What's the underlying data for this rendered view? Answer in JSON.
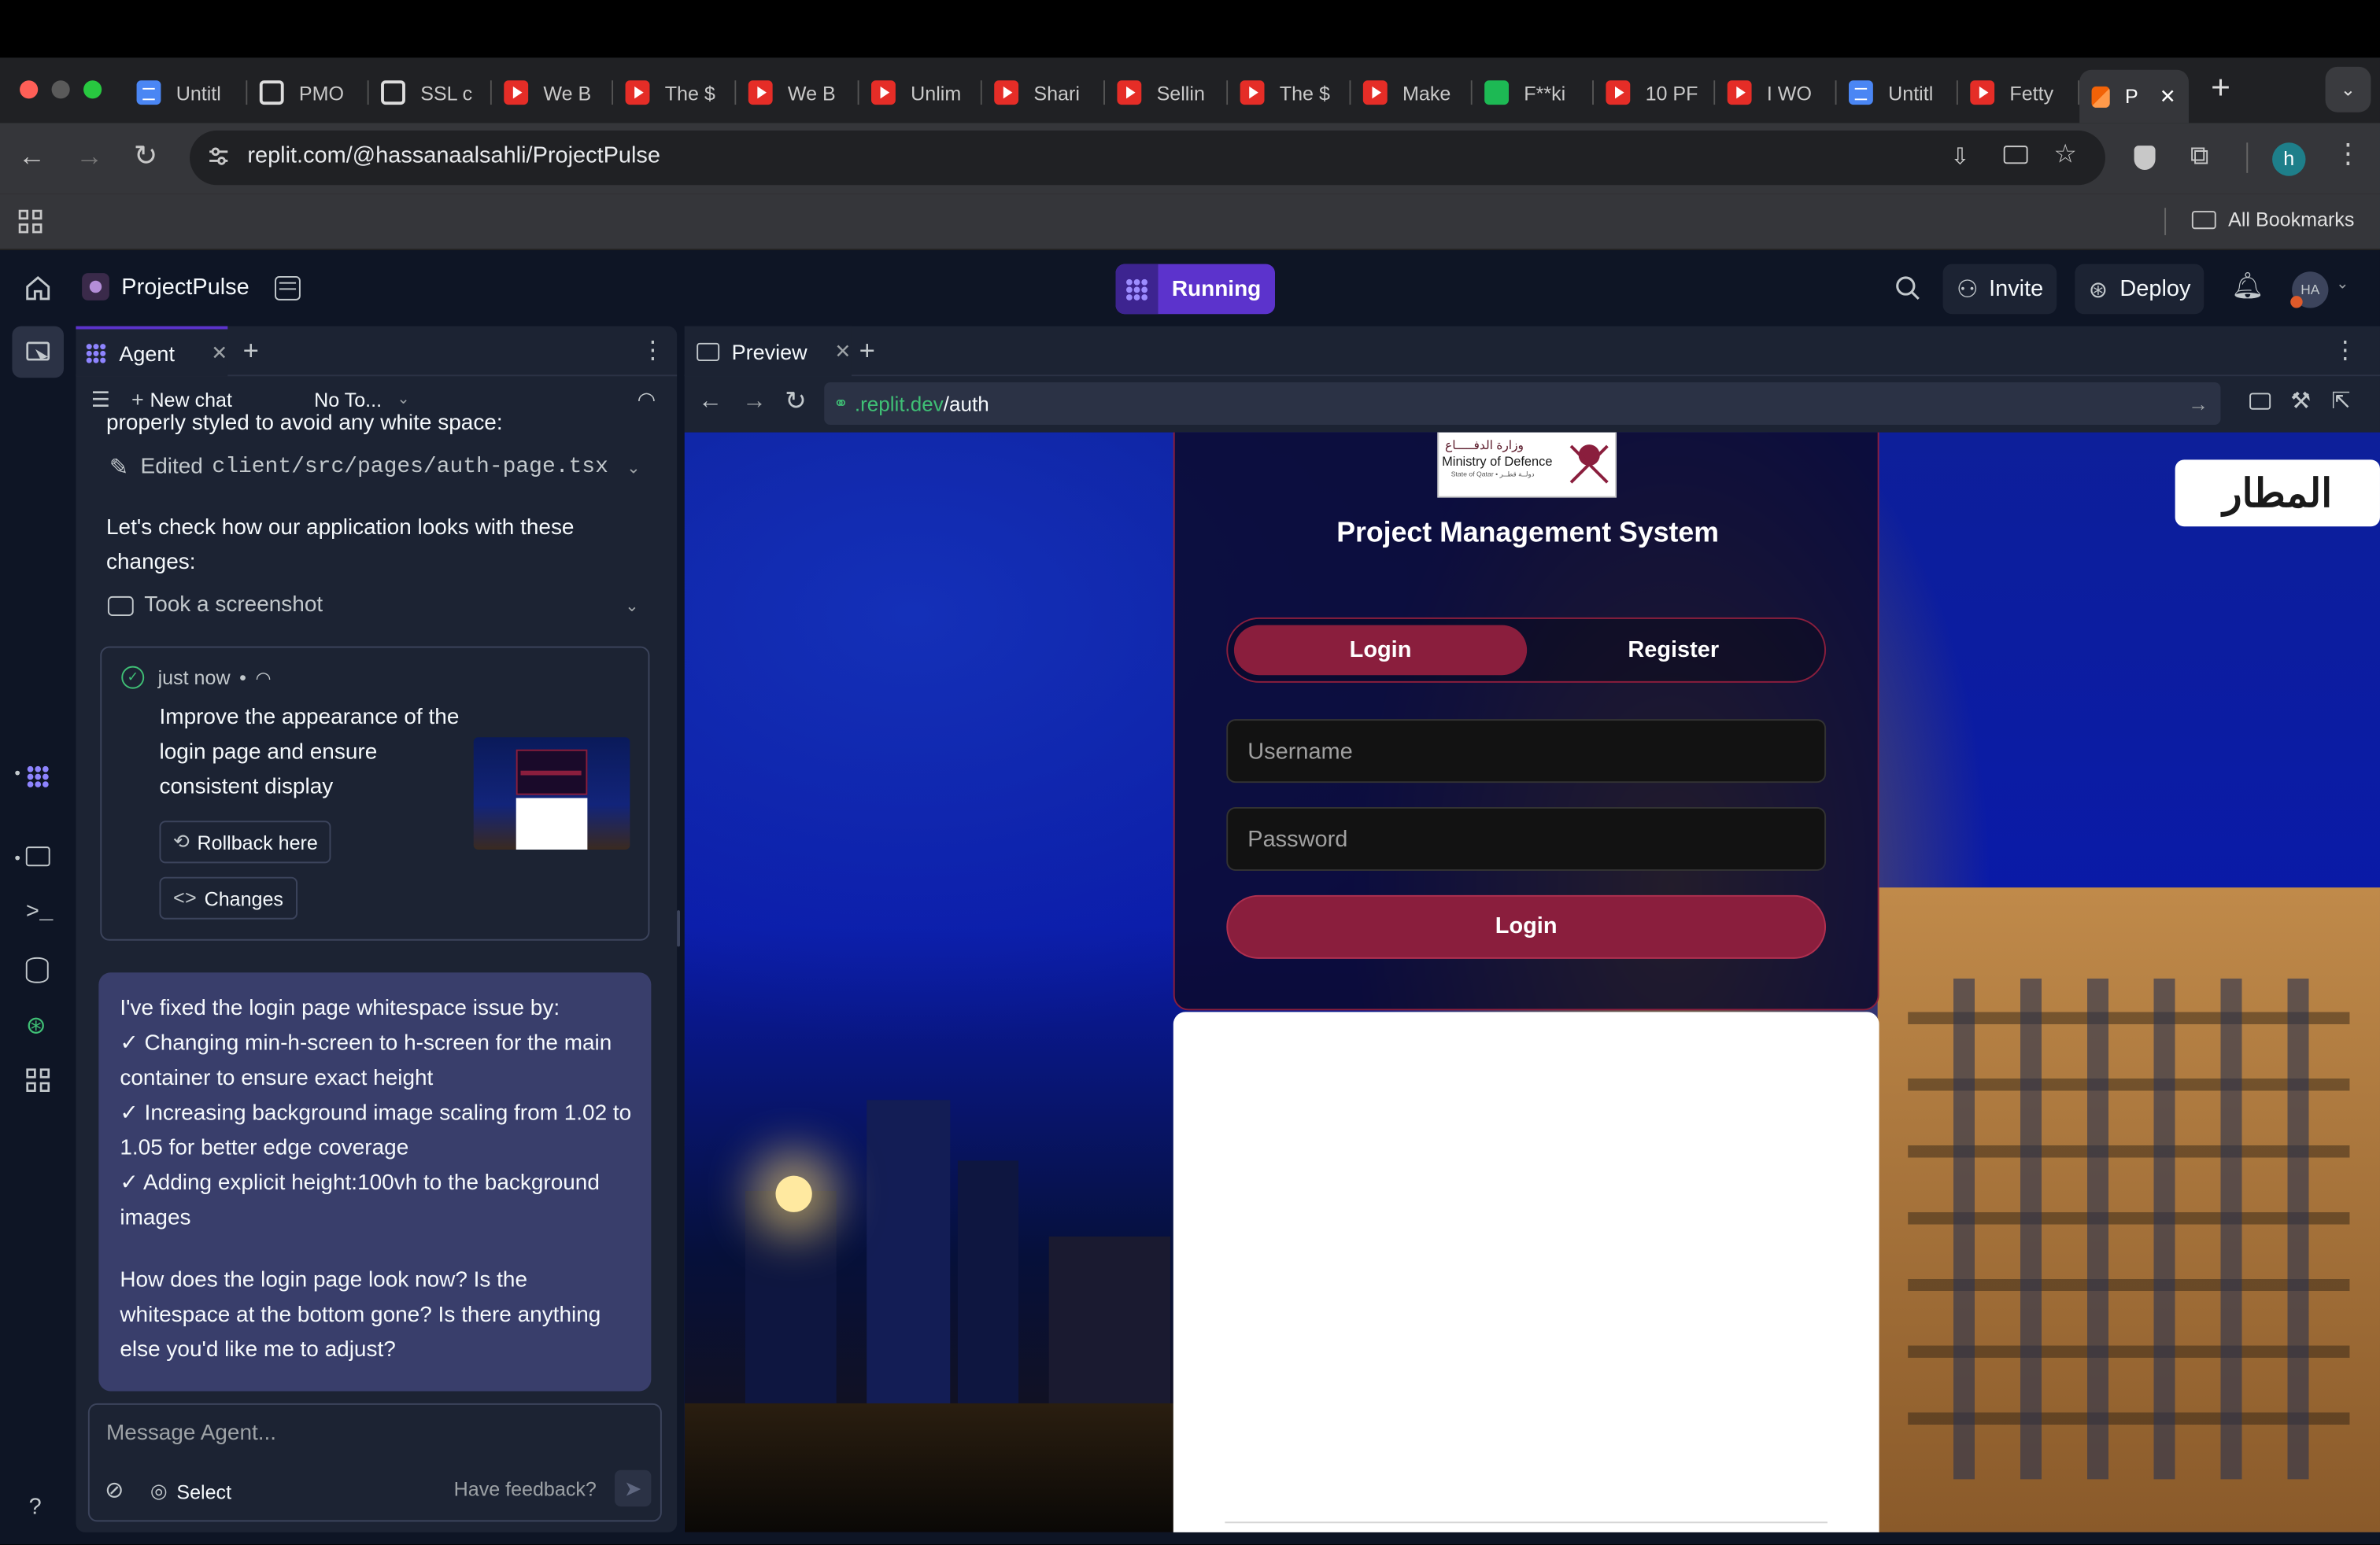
{
  "browser": {
    "tabs": [
      {
        "title": "Untitl",
        "icon": "docs"
      },
      {
        "title": "PMO",
        "icon": "chatgpt"
      },
      {
        "title": "SSL c",
        "icon": "chatgpt"
      },
      {
        "title": "We B",
        "icon": "youtube"
      },
      {
        "title": "The $",
        "icon": "youtube"
      },
      {
        "title": "We B",
        "icon": "youtube"
      },
      {
        "title": "Unlim",
        "icon": "youtube"
      },
      {
        "title": "Shari",
        "icon": "youtube"
      },
      {
        "title": "Sellin",
        "icon": "youtube"
      },
      {
        "title": "The $",
        "icon": "youtube"
      },
      {
        "title": "Make",
        "icon": "youtube"
      },
      {
        "title": "F**ki",
        "icon": "spotify"
      },
      {
        "title": "10 PF",
        "icon": "youtube"
      },
      {
        "title": "I WO",
        "icon": "youtube"
      },
      {
        "title": "Untitl",
        "icon": "docs"
      },
      {
        "title": "Fetty",
        "icon": "youtube"
      },
      {
        "title": "P",
        "icon": "replit",
        "active": true
      }
    ],
    "url": "replit.com/@hassanaalsahli/ProjectPulse",
    "all_bookmarks": "All Bookmarks",
    "profile_initial": "h"
  },
  "replit": {
    "project_name": "ProjectPulse",
    "run_status": "Running",
    "invite": "Invite",
    "deploy": "Deploy",
    "avatar": "HA",
    "accent": "#5c33cc"
  },
  "agent": {
    "tab_label": "Agent",
    "new_chat": "New chat",
    "model_select": "No To...",
    "truncated_text": "properly styled to avoid any white space:",
    "edit_label": "Edited",
    "edit_file": "client/src/pages/auth-page.tsx",
    "check_text": "Let's check how our application looks with these changes:",
    "screenshot_label": "Took a screenshot",
    "checkpoint": {
      "time": "just now",
      "separator": "•",
      "description": "Improve the appearance of the login page and ensure consistent display",
      "rollback": "Rollback here",
      "changes": "Changes"
    },
    "message": {
      "intro": "I've fixed the login page whitespace issue by:",
      "bullets": [
        "✓ Changing min-h-screen to h-screen for the main container to ensure exact height",
        "✓ Increasing background image scaling from 1.02 to 1.05 for better edge coverage",
        "✓ Adding explicit height:100vh to the background images"
      ],
      "question": "How does the login page look now? Is the whitespace at the bottom gone? Is there anything else you'd like me to adjust?"
    },
    "input_placeholder": "Message Agent...",
    "select_label": "Select",
    "feedback": "Have feedback?"
  },
  "preview": {
    "tab_label": "Preview",
    "url_domain": ".replit.dev",
    "url_path": "/auth",
    "logo_text_ar": "وزارة الدفـــــاع",
    "logo_text_en": "Ministry of Defence",
    "logo_subtext": "State of Qatar • دولــة قطــر",
    "system_title": "Project Management System",
    "toggle_login": "Login",
    "toggle_register": "Register",
    "username_placeholder": "Username",
    "password_placeholder": "Password",
    "submit": "Login",
    "bg_sign": "المطار",
    "accent": "#8a1e3d"
  }
}
